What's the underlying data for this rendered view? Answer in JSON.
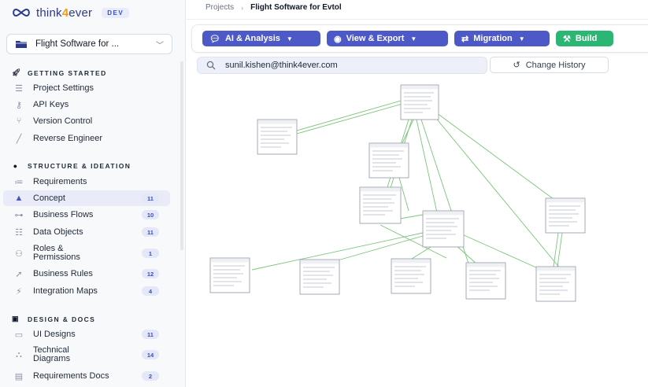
{
  "brand": {
    "name_pre": "think",
    "name_num": "4",
    "name_post": "ever",
    "env": "DEV"
  },
  "project": {
    "name": "Flight Software for ..."
  },
  "sidebar": {
    "sections": [
      {
        "title": "GETTING STARTED"
      },
      {
        "title": "STRUCTURE & IDEATION"
      },
      {
        "title": "DESIGN & DOCS"
      }
    ],
    "items": [
      {
        "label": "Project Settings"
      },
      {
        "label": "API Keys"
      },
      {
        "label": "Version Control"
      },
      {
        "label": "Reverse Engineer"
      },
      {
        "label": "Requirements"
      },
      {
        "label": "Concept",
        "count": "11"
      },
      {
        "label": "Business Flows",
        "count": "10"
      },
      {
        "label": "Data Objects",
        "count": "11"
      },
      {
        "label": "Roles & Permissions",
        "count": "1"
      },
      {
        "label": "Business Rules",
        "count": "12"
      },
      {
        "label": "Integration Maps",
        "count": "4"
      },
      {
        "label": "UI Designs",
        "count": "11"
      },
      {
        "label": "Technical Diagrams",
        "count": "14"
      },
      {
        "label": "Requirements Docs",
        "count": "2"
      }
    ]
  },
  "breadcrumb": {
    "root": "Projects",
    "current": "Flight Software for Evtol"
  },
  "toolbar": {
    "ai_label": "AI & Analysis",
    "view_label": "View & Export",
    "migration_label": "Migration",
    "build_label": "Build"
  },
  "search": {
    "value": "sunil.kishen@think4ever.com"
  },
  "history": {
    "label": "Change History"
  },
  "icons": [
    "folder-icon",
    "rocket-icon",
    "sliders-icon",
    "key-icon",
    "branch-icon",
    "wand-icon",
    "bulb-icon",
    "list-icon",
    "concept-icon",
    "flow-icon",
    "database-icon",
    "users-icon",
    "rules-icon",
    "plug-icon",
    "document-icon",
    "monitor-icon",
    "diagram-icon",
    "file-icon",
    "search-icon",
    "history-icon"
  ],
  "colors": {
    "primary": "#4d59c7",
    "build": "#2bb673",
    "edge": "#7cc47a",
    "brand": "#2b3a8a",
    "accent": "#f39c12"
  }
}
